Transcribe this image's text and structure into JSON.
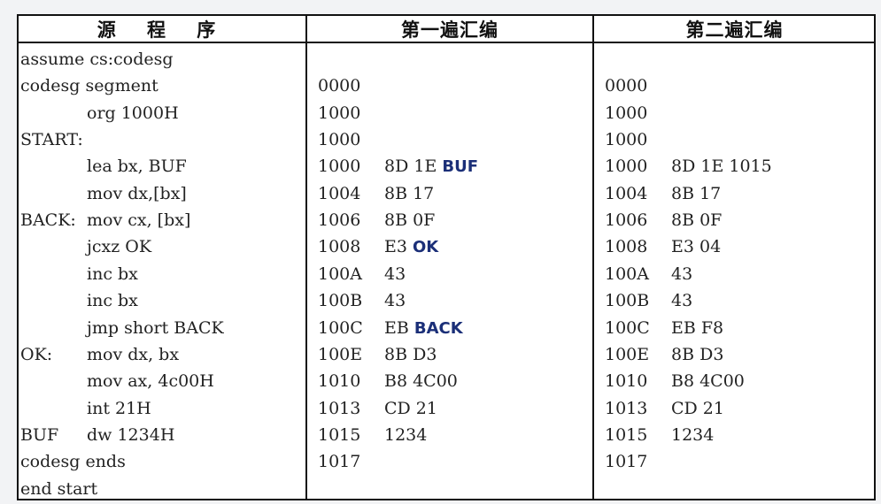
{
  "header": {
    "col_source": "源 程 序",
    "col_pass1": "第一遍汇编",
    "col_pass2": "第二遍汇编"
  },
  "rows": [
    {
      "label": "",
      "source": "assume cs:codesg",
      "addr1": "",
      "code1": "",
      "sym1": "",
      "addr2": "",
      "code2": ""
    },
    {
      "label": "",
      "source": "codesg segment",
      "addr1": "0000",
      "code1": "",
      "sym1": "",
      "addr2": "0000",
      "code2": ""
    },
    {
      "label": "",
      "source": "org 1000H",
      "addr1": "1000",
      "code1": "",
      "sym1": "",
      "addr2": "1000",
      "code2": ""
    },
    {
      "label": "START:",
      "source": "",
      "addr1": "1000",
      "code1": "",
      "sym1": "",
      "addr2": "1000",
      "code2": ""
    },
    {
      "label": "",
      "source": "lea bx, BUF",
      "addr1": "1000",
      "code1": "8D 1E ",
      "sym1": "BUF",
      "addr2": "1000",
      "code2": "8D 1E 1015"
    },
    {
      "label": "",
      "source": "mov dx,[bx]",
      "addr1": "1004",
      "code1": "8B 17",
      "sym1": "",
      "addr2": "1004",
      "code2": "8B 17"
    },
    {
      "label": "BACK:",
      "source": "mov cx, [bx]",
      "addr1": "1006",
      "code1": "8B 0F",
      "sym1": "",
      "addr2": "1006",
      "code2": "8B 0F"
    },
    {
      "label": "",
      "source": "jcxz OK",
      "addr1": "1008",
      "code1": "E3 ",
      "sym1": "OK",
      "addr2": "1008",
      "code2": "E3 04"
    },
    {
      "label": "",
      "source": "inc bx",
      "addr1": "100A",
      "code1": "43",
      "sym1": "",
      "addr2": "100A",
      "code2": "43"
    },
    {
      "label": "",
      "source": "inc bx",
      "addr1": "100B",
      "code1": "43",
      "sym1": "",
      "addr2": "100B",
      "code2": "43"
    },
    {
      "label": "",
      "source": "jmp short BACK",
      "addr1": "100C",
      "code1": "EB ",
      "sym1": "BACK",
      "addr2": "100C",
      "code2": "EB F8"
    },
    {
      "label": "OK:",
      "source": "mov dx, bx",
      "addr1": "100E",
      "code1": "8B D3",
      "sym1": "",
      "addr2": "100E",
      "code2": "8B D3"
    },
    {
      "label": "",
      "source": "mov ax, 4c00H",
      "addr1": "1010",
      "code1": "B8 4C00",
      "sym1": "",
      "addr2": "1010",
      "code2": "B8 4C00"
    },
    {
      "label": "",
      "source": "int 21H",
      "addr1": "1013",
      "code1": "CD 21",
      "sym1": "",
      "addr2": "1013",
      "code2": "CD 21"
    },
    {
      "label": "BUF",
      "source": "dw 1234H",
      "addr1": "1015",
      "code1": "1234",
      "sym1": "",
      "addr2": "1015",
      "code2": "1234"
    },
    {
      "label": "",
      "source": "codesg ends",
      "addr1": "1017",
      "code1": "",
      "sym1": "",
      "addr2": "1017",
      "code2": ""
    },
    {
      "label": "",
      "source": "end start",
      "addr1": "",
      "code1": "",
      "sym1": "",
      "addr2": "",
      "code2": ""
    }
  ]
}
